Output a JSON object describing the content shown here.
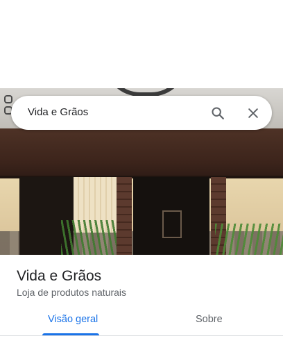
{
  "search": {
    "query": "Vida e Grãos"
  },
  "place": {
    "name": "Vida e Grãos",
    "category": "Loja de produtos naturais"
  },
  "tabs": [
    {
      "label": "Visão geral",
      "active": true
    },
    {
      "label": "Sobre",
      "active": false
    }
  ],
  "icons": {
    "search": "search-icon",
    "close": "close-icon"
  },
  "colors": {
    "accent": "#1a73e8",
    "text_primary": "#202124",
    "text_secondary": "#5f6368"
  }
}
